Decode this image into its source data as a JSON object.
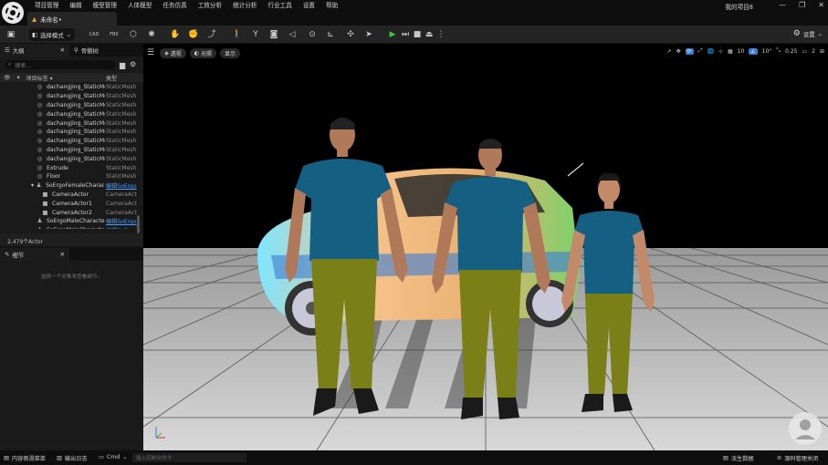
{
  "menu": [
    "项目管理",
    "编辑",
    "模型管理",
    "人体模型",
    "任务仿真",
    "工效分析",
    "统计分析",
    "行业工具",
    "设置",
    "帮助"
  ],
  "document_tab": "未命名•",
  "project_name": "我的项目8",
  "window_controls": [
    "—",
    "❐",
    "✕"
  ],
  "toolbar": {
    "mode_label": "选择模式",
    "settings_label": "设置",
    "cad_label": "CAD",
    "fbx_label": "FBX"
  },
  "outliner": {
    "tab_label": "大纲",
    "tab2_label": "骨骼树",
    "search_placeholder": "搜索...",
    "col_label": "项目标签",
    "col_type": "类型",
    "rows": [
      {
        "name": "dachangjing_StaticMes",
        "type": "StaticMesh",
        "icon": "mesh-icon",
        "indent": 0,
        "link": false
      },
      {
        "name": "dachangjing_StaticMes",
        "type": "StaticMesh",
        "icon": "mesh-icon",
        "indent": 0,
        "link": false
      },
      {
        "name": "dachangjing_StaticMes",
        "type": "StaticMesh",
        "icon": "mesh-icon",
        "indent": 0,
        "link": false
      },
      {
        "name": "dachangjing_StaticMes",
        "type": "StaticMesh",
        "icon": "mesh-icon",
        "indent": 0,
        "link": false
      },
      {
        "name": "dachangjing_StaticMes",
        "type": "StaticMesh",
        "icon": "mesh-icon",
        "indent": 0,
        "link": false
      },
      {
        "name": "dachangjing_StaticMes",
        "type": "StaticMesh",
        "icon": "mesh-icon",
        "indent": 0,
        "link": false
      },
      {
        "name": "dachangjing_StaticMes",
        "type": "StaticMesh",
        "icon": "mesh-icon",
        "indent": 0,
        "link": false
      },
      {
        "name": "dachangjing_StaticMes",
        "type": "StaticMesh",
        "icon": "mesh-icon",
        "indent": 0,
        "link": false
      },
      {
        "name": "dachangjing_StaticMes",
        "type": "StaticMesh",
        "icon": "mesh-icon",
        "indent": 0,
        "link": false
      },
      {
        "name": "Extrude",
        "type": "StaticMesh",
        "icon": "mesh-icon",
        "indent": 0,
        "link": false
      },
      {
        "name": "Floor",
        "type": "StaticMesh",
        "icon": "mesh-icon",
        "indent": 0,
        "link": false
      },
      {
        "name": "SoErgoFemaleCharacte",
        "type": "编辑SoErgo",
        "icon": "character-icon",
        "indent": 0,
        "link": true,
        "expander": true
      },
      {
        "name": "CameraActor",
        "type": "CameraActo",
        "icon": "camera-icon",
        "indent": 1,
        "link": false
      },
      {
        "name": "CameraActor1",
        "type": "CameraActo",
        "icon": "camera-icon",
        "indent": 1,
        "link": false
      },
      {
        "name": "CameraActor2",
        "type": "CameraActo",
        "icon": "camera-icon",
        "indent": 1,
        "link": false
      },
      {
        "name": "SoErgoMaleCharacter",
        "type": "编辑SoErgo",
        "icon": "character-icon",
        "indent": 0,
        "link": true
      },
      {
        "name": "SoErgoMaleCharacter1",
        "type": "编辑SoErgo",
        "icon": "character-icon",
        "indent": 0,
        "link": true
      }
    ],
    "count_label": "2,479个Actor"
  },
  "details": {
    "tab_label": "细节",
    "hint": "选择一个对象来查看细节。"
  },
  "viewport": {
    "perspective_label": "透视",
    "lit_label": "光照",
    "show_label": "显示",
    "grid_value": "10",
    "angle_value": "10°",
    "scale_value": "0.25",
    "camera_speed": "2"
  },
  "statusbar": {
    "content_drawer": "内容侧滑菜单",
    "output_log": "输出日志",
    "cmd_label": "Cmd",
    "cmd_placeholder": "输入控制台命令",
    "derived_data": "派生数据",
    "source_control": "源码管理关闭"
  }
}
